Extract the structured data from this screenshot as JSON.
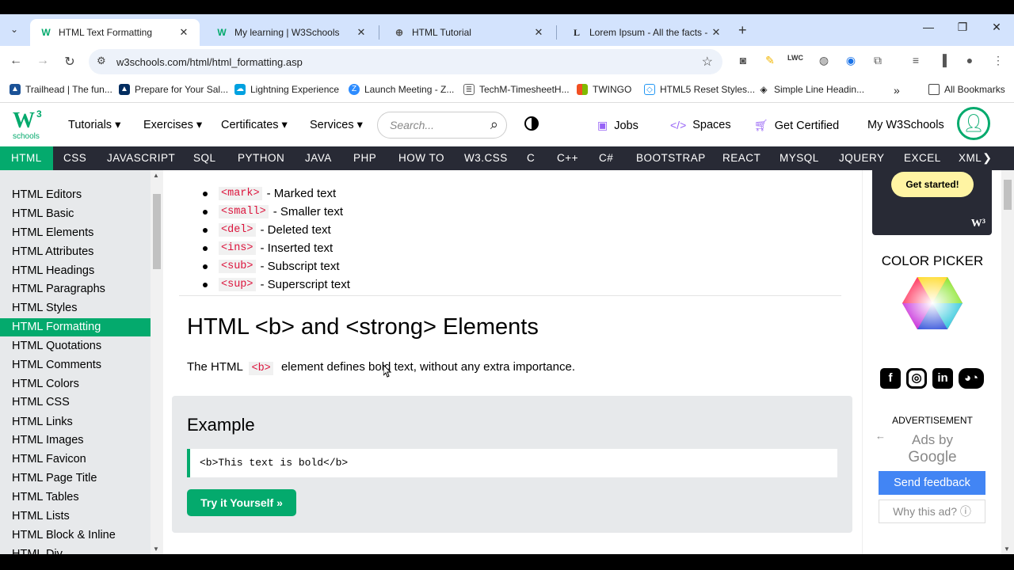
{
  "browser": {
    "tabs": [
      {
        "favicon": "W",
        "title": "HTML Text Formatting",
        "active": true
      },
      {
        "favicon": "W",
        "title": "My learning | W3Schools",
        "active": false
      },
      {
        "favicon": "⊕",
        "title": "HTML Tutorial",
        "active": false
      },
      {
        "favicon": "L",
        "title": "Lorem Ipsum - All the facts - Lip",
        "active": false
      }
    ],
    "url": "w3schools.com/html/html_formatting.asp",
    "bookmarks": [
      {
        "label": "Trailhead | The fun...",
        "color": "#1b5297"
      },
      {
        "label": "Prepare for Your Sal...",
        "color": "#032d60"
      },
      {
        "label": "Lightning Experience",
        "color": "#00a1e0"
      },
      {
        "label": "Launch Meeting - Z...",
        "color": "#2d8cff"
      },
      {
        "label": "TechM-TimesheetH...",
        "color": "#666666"
      },
      {
        "label": "TWINGO",
        "color": "#f25022"
      },
      {
        "label": "HTML5 Reset Styles...",
        "color": "#2196f3"
      },
      {
        "label": "Simple Line Headin...",
        "color": "#222222"
      }
    ],
    "all_bookmarks": "All Bookmarks"
  },
  "header": {
    "logo_text": "W",
    "logo_sup": "3",
    "logo_sub": "schools",
    "menu": [
      "Tutorials ▾",
      "Exercises ▾",
      "Certificates ▾",
      "Services ▾"
    ],
    "search_placeholder": "Search...",
    "jobs": "Jobs",
    "spaces": "Spaces",
    "get_certified": "Get Certified",
    "my_w3schools": "My W3Schools"
  },
  "topics": [
    "HTML",
    "CSS",
    "JAVASCRIPT",
    "SQL",
    "PYTHON",
    "JAVA",
    "PHP",
    "HOW TO",
    "W3.CSS",
    "C",
    "C++",
    "C#",
    "BOOTSTRAP",
    "REACT",
    "MYSQL",
    "JQUERY",
    "EXCEL",
    "XML"
  ],
  "sidebar": {
    "items": [
      "HTML Editors",
      "HTML Basic",
      "HTML Elements",
      "HTML Attributes",
      "HTML Headings",
      "HTML Paragraphs",
      "HTML Styles",
      "HTML Formatting",
      "HTML Quotations",
      "HTML Comments",
      "HTML Colors",
      "HTML CSS",
      "HTML Links",
      "HTML Images",
      "HTML Favicon",
      "HTML Page Title",
      "HTML Tables",
      "HTML Lists",
      "HTML Block & Inline",
      "HTML Div"
    ],
    "active_index": 7
  },
  "main": {
    "list": [
      {
        "tag": "<mark>",
        "text": "- Marked text"
      },
      {
        "tag": "<small>",
        "text": "- Smaller text"
      },
      {
        "tag": "<del>",
        "text": "- Deleted text"
      },
      {
        "tag": "<ins>",
        "text": "- Inserted text"
      },
      {
        "tag": "<sub>",
        "text": "- Subscript text"
      },
      {
        "tag": "<sup>",
        "text": "- Superscript text"
      }
    ],
    "heading": "HTML <b> and <strong> Elements",
    "para_before": "The HTML",
    "para_code": "<b>",
    "para_after": "element defines bold text, without any extra importance.",
    "example_title": "Example",
    "example_code": "<b>This text is bold</b>",
    "try_button": "Try it Yourself »"
  },
  "right": {
    "get_started": "Get started!",
    "color_picker": "COLOR PICKER",
    "advertisement": "ADVERTISEMENT",
    "ads_by": "Ads by",
    "google": "Google",
    "send_feedback": "Send feedback",
    "why_ad": "Why this ad? ⓘ"
  },
  "colors": {
    "brand_green": "#04aa6d",
    "topics_bar": "#282a35",
    "code_red": "#dc143c",
    "accent_purple": "#9763f6"
  }
}
